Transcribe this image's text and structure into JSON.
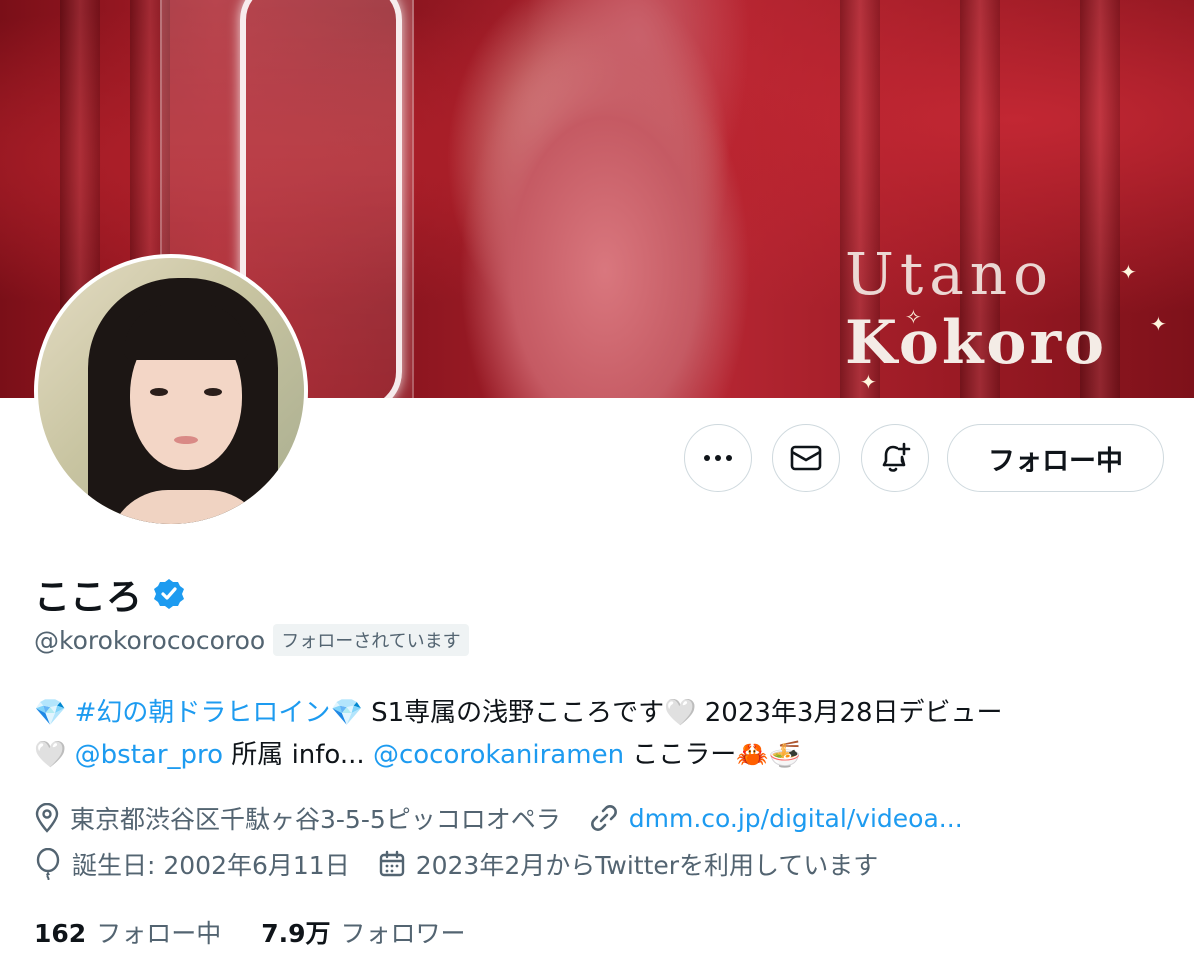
{
  "banner": {
    "title_line1": "Utano",
    "title_line2": "Kokoro"
  },
  "profile": {
    "display_name": "こころ",
    "handle": "@korokorococoroo",
    "follows_you": "フォローされています",
    "verified": true
  },
  "actions": {
    "more_icon": "more-icon",
    "message_icon": "mail-icon",
    "notify_icon": "bell-plus-icon",
    "follow_label": "フォロー中"
  },
  "bio": {
    "emoji_diamond": "💎",
    "hashtag": "#幻の朝ドラヒロイン",
    "text1": " S1専属の浅野こころです",
    "emoji_heart": "🤍",
    "text2": " 2023年3月28日デビュー",
    "mention1": "@bstar_pro",
    "text3": " 所属 info... ",
    "mention2": "@cocorokaniramen",
    "text4": " ここラー",
    "emoji_crab": "🦀",
    "emoji_ramen": "🍜"
  },
  "meta": {
    "location": "東京都渋谷区千駄ヶ谷3-5-5ピッコロオペラ",
    "website": "dmm.co.jp/digital/videoa...",
    "birthday": "誕生日: 2002年6月11日",
    "joined": "2023年2月からTwitterを利用しています"
  },
  "stats": {
    "following_count": "162",
    "following_label": "フォロー中",
    "followers_count": "7.9万",
    "followers_label": "フォロワー"
  },
  "colors": {
    "accent": "#1d9bf0",
    "secondary_text": "#536471",
    "primary_text": "#0f1419",
    "border": "#cfd9de"
  }
}
